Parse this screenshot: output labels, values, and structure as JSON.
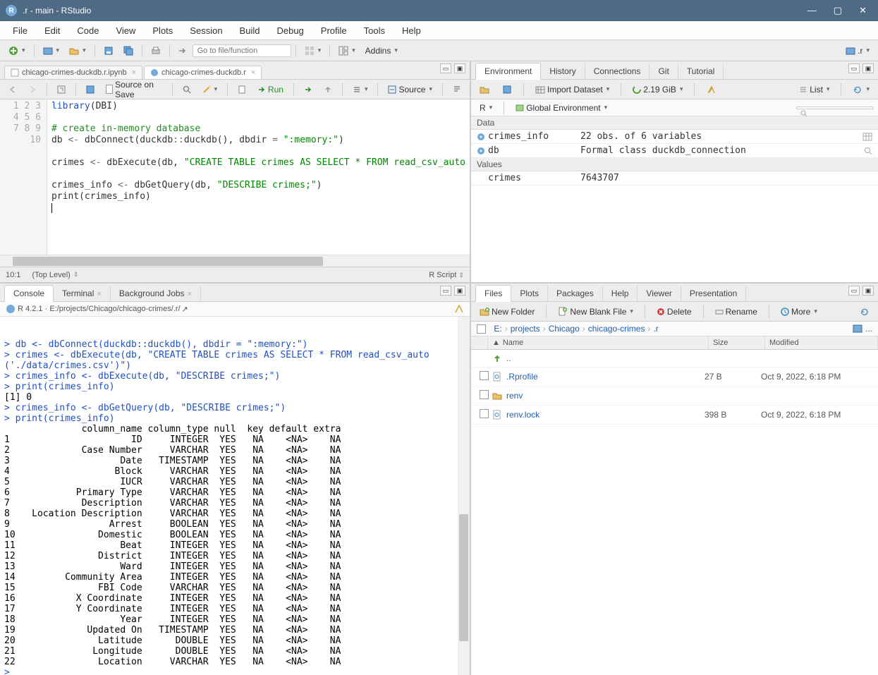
{
  "window": {
    "title": ".r - main - RStudio"
  },
  "menubar": [
    "File",
    "Edit",
    "Code",
    "View",
    "Plots",
    "Session",
    "Build",
    "Debug",
    "Profile",
    "Tools",
    "Help"
  ],
  "maintoolbar": {
    "goto_placeholder": "Go to file/function",
    "addins": "Addins",
    "project": ".r"
  },
  "source": {
    "tabs": [
      {
        "label": "chicago-crimes-duckdb.r.ipynb",
        "active": false
      },
      {
        "label": "chicago-crimes-duckdb.r",
        "active": true
      }
    ],
    "toolbar": {
      "source_on_save": "Source on Save",
      "run": "Run",
      "source_btn": "Source"
    },
    "lines": 10,
    "code": {
      "l1": "library(DBI)",
      "l2": "",
      "l3": "# create in-memory database",
      "l4a": "db <- dbConnect(duckdb::duckdb(), dbdir = ",
      "l4b": "\":memory:\"",
      "l4c": ")",
      "l5": "",
      "l6a": "crimes <- dbExecute(db, ",
      "l6b": "\"CREATE TABLE crimes AS SELECT * FROM read_csv_auto",
      "l7": "",
      "l8a": "crimes_info <- dbGetQuery(db, ",
      "l8b": "\"DESCRIBE crimes;\"",
      "l8c": ")",
      "l9": "print(crimes_info)"
    },
    "status": {
      "pos": "10:1",
      "scope": "(Top Level)",
      "type": "R Script"
    }
  },
  "console_panel": {
    "tabs": [
      "Console",
      "Terminal",
      "Background Jobs"
    ],
    "header": {
      "version": "R 4.2.1",
      "path": "E:/projects/Chicago/chicago-crimes/.r/"
    },
    "lines": [
      {
        "t": "prompt",
        "txt": "> db <- dbConnect(duckdb::duckdb(), dbdir = \":memory:\")"
      },
      {
        "t": "prompt",
        "txt": "> crimes <- dbExecute(db, \"CREATE TABLE crimes AS SELECT * FROM read_csv_auto"
      },
      {
        "t": "prompt",
        "txt": "('./data/crimes.csv')\")"
      },
      {
        "t": "prompt",
        "txt": "> crimes_info <- dbExecute(db, \"DESCRIBE crimes;\")"
      },
      {
        "t": "prompt",
        "txt": "> print(crimes_info)"
      },
      {
        "t": "out",
        "txt": "[1] 0"
      },
      {
        "t": "prompt",
        "txt": "> crimes_info <- dbGetQuery(db, \"DESCRIBE crimes;\")"
      },
      {
        "t": "prompt",
        "txt": "> print(crimes_info)"
      },
      {
        "t": "out",
        "txt": "              column_name column_type null  key default extra"
      },
      {
        "t": "out",
        "txt": "1                      ID     INTEGER  YES   NA    <NA>    NA"
      },
      {
        "t": "out",
        "txt": "2             Case Number     VARCHAR  YES   NA    <NA>    NA"
      },
      {
        "t": "out",
        "txt": "3                    Date   TIMESTAMP  YES   NA    <NA>    NA"
      },
      {
        "t": "out",
        "txt": "4                   Block     VARCHAR  YES   NA    <NA>    NA"
      },
      {
        "t": "out",
        "txt": "5                    IUCR     VARCHAR  YES   NA    <NA>    NA"
      },
      {
        "t": "out",
        "txt": "6            Primary Type     VARCHAR  YES   NA    <NA>    NA"
      },
      {
        "t": "out",
        "txt": "7             Description     VARCHAR  YES   NA    <NA>    NA"
      },
      {
        "t": "out",
        "txt": "8    Location Description     VARCHAR  YES   NA    <NA>    NA"
      },
      {
        "t": "out",
        "txt": "9                  Arrest     BOOLEAN  YES   NA    <NA>    NA"
      },
      {
        "t": "out",
        "txt": "10               Domestic     BOOLEAN  YES   NA    <NA>    NA"
      },
      {
        "t": "out",
        "txt": "11                   Beat     INTEGER  YES   NA    <NA>    NA"
      },
      {
        "t": "out",
        "txt": "12               District     INTEGER  YES   NA    <NA>    NA"
      },
      {
        "t": "out",
        "txt": "13                   Ward     INTEGER  YES   NA    <NA>    NA"
      },
      {
        "t": "out",
        "txt": "14         Community Area     INTEGER  YES   NA    <NA>    NA"
      },
      {
        "t": "out",
        "txt": "15               FBI Code     VARCHAR  YES   NA    <NA>    NA"
      },
      {
        "t": "out",
        "txt": "16           X Coordinate     INTEGER  YES   NA    <NA>    NA"
      },
      {
        "t": "out",
        "txt": "17           Y Coordinate     INTEGER  YES   NA    <NA>    NA"
      },
      {
        "t": "out",
        "txt": "18                   Year     INTEGER  YES   NA    <NA>    NA"
      },
      {
        "t": "out",
        "txt": "19             Updated On   TIMESTAMP  YES   NA    <NA>    NA"
      },
      {
        "t": "out",
        "txt": "20               Latitude      DOUBLE  YES   NA    <NA>    NA"
      },
      {
        "t": "out",
        "txt": "21              Longitude      DOUBLE  YES   NA    <NA>    NA"
      },
      {
        "t": "out",
        "txt": "22               Location     VARCHAR  YES   NA    <NA>    NA"
      },
      {
        "t": "prompt",
        "txt": "> "
      }
    ]
  },
  "env_panel": {
    "tabs": [
      "Environment",
      "History",
      "Connections",
      "Git",
      "Tutorial"
    ],
    "toolbar": {
      "import": "Import Dataset",
      "mem": "2.19 GiB",
      "view": "List"
    },
    "scope": {
      "lang": "R",
      "env": "Global Environment"
    },
    "sections": [
      {
        "title": "Data",
        "rows": [
          {
            "name": "crimes_info",
            "value": "22 obs. of 6 variables",
            "ico": "table"
          },
          {
            "name": "db",
            "value": "Formal class  duckdb_connection",
            "ico": "search"
          }
        ]
      },
      {
        "title": "Values",
        "rows": [
          {
            "name": "crimes",
            "value": "7643707",
            "ico": ""
          }
        ]
      }
    ]
  },
  "files_panel": {
    "tabs": [
      "Files",
      "Plots",
      "Packages",
      "Help",
      "Viewer",
      "Presentation"
    ],
    "toolbar": {
      "new_folder": "New Folder",
      "new_file": "New Blank File",
      "delete": "Delete",
      "rename": "Rename",
      "more": "More"
    },
    "breadcrumb": [
      "E:",
      "projects",
      "Chicago",
      "chicago-crimes",
      ".r"
    ],
    "columns": {
      "name": "Name",
      "size": "Size",
      "modified": "Modified"
    },
    "up": "..",
    "rows": [
      {
        "name": ".Rprofile",
        "size": "27 B",
        "modified": "Oct 9, 2022, 6:18 PM",
        "icon": "gear"
      },
      {
        "name": "renv",
        "size": "",
        "modified": "",
        "icon": "folder"
      },
      {
        "name": "renv.lock",
        "size": "398 B",
        "modified": "Oct 9, 2022, 6:18 PM",
        "icon": "gear"
      }
    ]
  }
}
